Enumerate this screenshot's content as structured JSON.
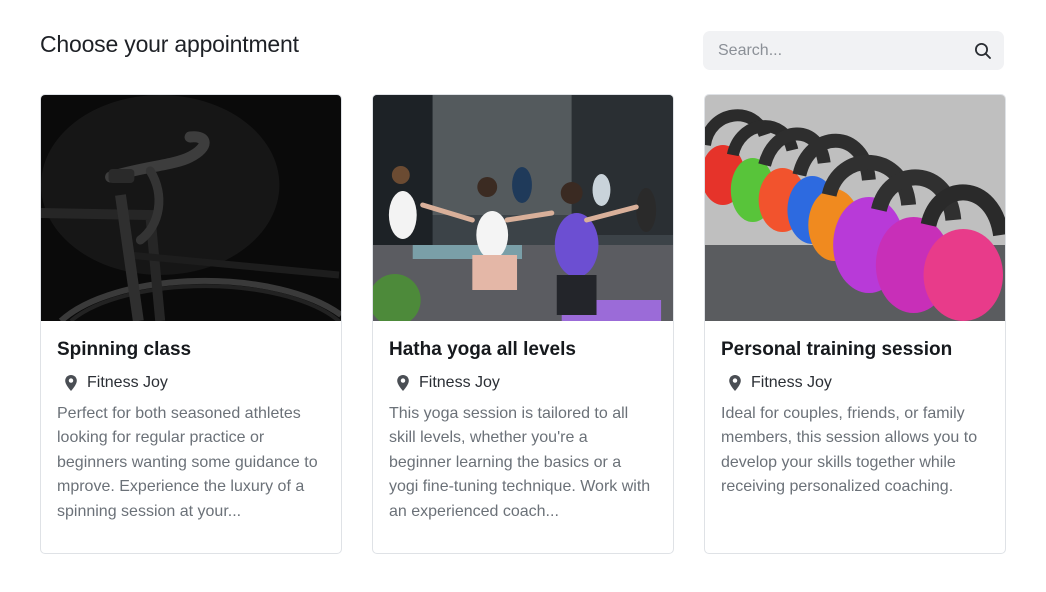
{
  "header": {
    "title": "Choose your appointment"
  },
  "search": {
    "placeholder": "Search...",
    "icon": "search-icon"
  },
  "cards": [
    {
      "title": "Spinning class",
      "location": "Fitness Joy",
      "description": "Perfect for both seasoned athletes looking for regular practice or beginners wanting some guidance to mprove. Experience the luxury of a spinning session at your...",
      "image": "bicycle-photo"
    },
    {
      "title": "Hatha yoga all levels",
      "location": "Fitness Joy",
      "description": "This yoga session is tailored to all skill levels, whether you're a beginner learning the basics or a yogi fine-tuning technique. Work with an experienced coach...",
      "image": "yoga-class-photo"
    },
    {
      "title": "Personal training session",
      "location": "Fitness Joy",
      "description": "Ideal for couples, friends, or family members, this session allows you to develop your skills together while receiving personalized coaching.",
      "image": "kettlebells-photo"
    }
  ],
  "icons": {
    "location": "map-pin-icon"
  }
}
